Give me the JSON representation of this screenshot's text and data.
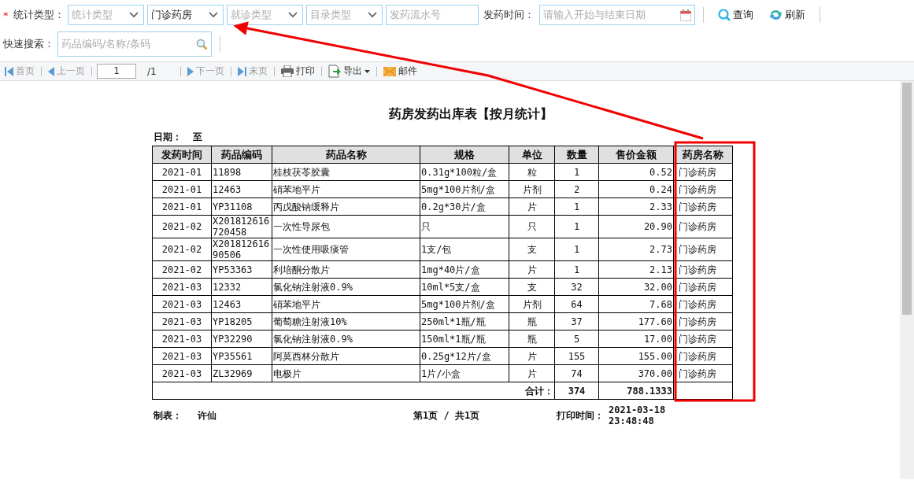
{
  "filters": {
    "required_mark": "*",
    "label": "统计类型：",
    "selects": [
      {
        "placeholder": "统计类型"
      },
      {
        "value": "门诊药房"
      },
      {
        "placeholder": "就诊类型"
      },
      {
        "placeholder": "目录类型"
      }
    ],
    "serial_field": {
      "placeholder": "发药流水号"
    },
    "date_label": "发药时间：",
    "date_field": {
      "placeholder": "请输入开始与结束日期"
    },
    "buttons": [
      {
        "label": "查询",
        "kind": "search"
      },
      {
        "label": "刷新",
        "kind": "refresh"
      }
    ]
  },
  "quick_search": {
    "label": "快速搜索：",
    "placeholder": "药品编码/名称/条码"
  },
  "pager": {
    "nav_before": [
      {
        "label": "首页",
        "kind": "first",
        "disabled": true
      },
      {
        "label": "上一页",
        "kind": "prev",
        "disabled": true
      }
    ],
    "page_value": "1",
    "page_total": "/1",
    "nav_after": [
      {
        "label": "下一页",
        "kind": "next",
        "disabled": true
      },
      {
        "label": "末页",
        "kind": "last",
        "disabled": true
      }
    ],
    "tools": [
      {
        "label": "打印",
        "kind": "print"
      },
      {
        "label": "导出",
        "kind": "export"
      },
      {
        "label": "邮件",
        "kind": "mail"
      }
    ]
  },
  "report": {
    "title": "药房发药出库表【按月统计】",
    "date_label": "日期：",
    "date_to": "至",
    "columns": [
      "发药时间",
      "药品编码",
      "药品名称",
      "规格",
      "单位",
      "数量",
      "售价金额",
      "药房名称"
    ],
    "rows": [
      [
        "2021-01",
        "11898",
        "桂枝茯苓胶囊",
        "0.31g*100粒/盒",
        "粒",
        "1",
        "0.52",
        "门诊药房"
      ],
      [
        "2021-01",
        "12463",
        "硝苯地平片",
        "5mg*100片剂/盒",
        "片剂",
        "2",
        "0.24",
        "门诊药房"
      ],
      [
        "2021-01",
        "YP31108",
        "丙戊酸钠缓释片",
        "0.2g*30片/盒",
        "片",
        "1",
        "2.33",
        "门诊药房"
      ],
      [
        "2021-02",
        "X201812616720458",
        "一次性导尿包",
        "只",
        "只",
        "1",
        "20.90",
        "门诊药房"
      ],
      [
        "2021-02",
        "X20181261690506",
        "一次性使用吸痰管",
        "1支/包",
        "支",
        "1",
        "2.73",
        "门诊药房"
      ],
      [
        "2021-02",
        "YP53363",
        "利培酮分散片",
        "1mg*40片/盒",
        "片",
        "1",
        "2.13",
        "门诊药房"
      ],
      [
        "2021-03",
        "12332",
        "氯化钠注射液0.9%",
        "10ml*5支/盒",
        "支",
        "32",
        "32.00",
        "门诊药房"
      ],
      [
        "2021-03",
        "12463",
        "硝苯地平片",
        "5mg*100片剂/盒",
        "片剂",
        "64",
        "7.68",
        "门诊药房"
      ],
      [
        "2021-03",
        "YP18205",
        "葡萄糖注射液10%",
        "250ml*1瓶/瓶",
        "瓶",
        "37",
        "177.60",
        "门诊药房"
      ],
      [
        "2021-03",
        "YP32290",
        "氯化钠注射液0.9%",
        "150ml*1瓶/瓶",
        "瓶",
        "5",
        "17.00",
        "门诊药房"
      ],
      [
        "2021-03",
        "YP35561",
        "阿莫西林分散片",
        "0.25g*12片/盒",
        "片",
        "155",
        "155.00",
        "门诊药房"
      ],
      [
        "2021-03",
        "ZL32969",
        "电极片",
        "1片/小盒",
        "片",
        "74",
        "370.00",
        "门诊药房"
      ]
    ],
    "total_label": "合计：",
    "total_qty": "374",
    "total_amount": "788.1333",
    "maker_label": "制表：",
    "maker": "许仙",
    "page_info": "第1页 / 共1页",
    "print_label": "打印时间：",
    "print_date": "2021-03-18",
    "print_clock": "23:48:48"
  }
}
